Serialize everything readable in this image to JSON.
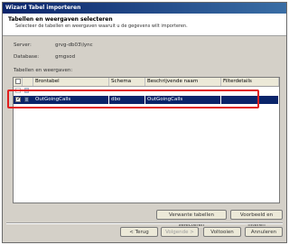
{
  "window": {
    "title": "Wizard Tabel importeren"
  },
  "header": {
    "title": "Tabellen en weergaven selecteren",
    "description": "Selecteer de tabellen en weergaven waaruit u de gegevens wilt importeren."
  },
  "fields": {
    "server_label": "Server:",
    "server_value": "grvg-db03\\lync",
    "database_label": "Database:",
    "database_value": "gmgsod"
  },
  "list": {
    "label": "Tabellen en weergaven:",
    "columns": [
      "Brontabel",
      "Schema",
      "Beschrijvende naam",
      "Filterdetails"
    ],
    "rows": [
      {
        "source": "OutGoingCalls",
        "schema": "dbo",
        "friendly": "OutGoingCalls",
        "checked": true
      }
    ]
  },
  "buttons": {
    "select_related": "Verwante tabellen selecteren",
    "preview_filter": "Voorbeeld en filteren",
    "back": "< Terug",
    "next": "Volgende >",
    "finish": "Voltooien",
    "cancel": "Annuleren"
  },
  "colors": {
    "selection": "#0a246a",
    "highlight": "#e01e1e",
    "titlebar": "#0a246a"
  }
}
